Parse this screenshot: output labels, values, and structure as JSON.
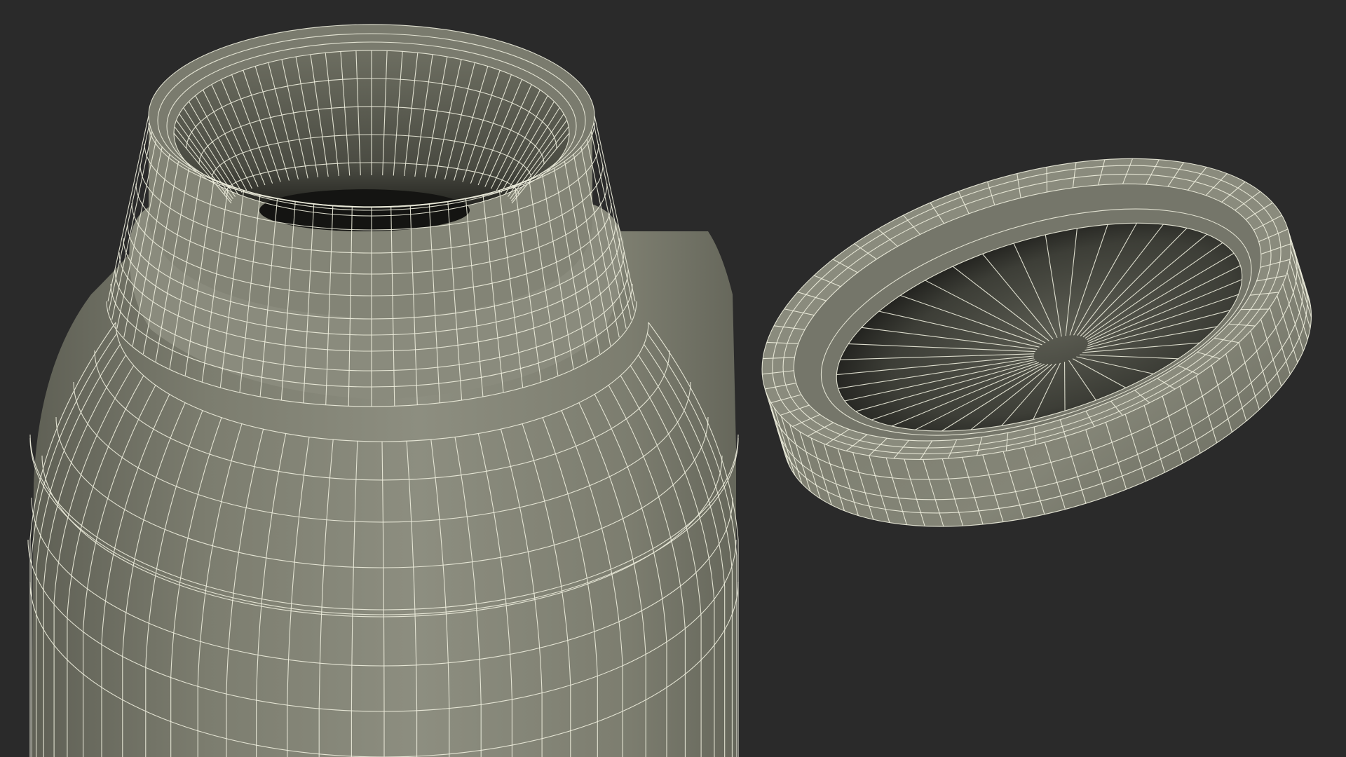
{
  "scene": {
    "description_visible_text": "",
    "objects": [
      {
        "name": "jar-body",
        "kind": "wireframe-mesh"
      },
      {
        "name": "jar-lid",
        "kind": "wireframe-mesh"
      }
    ]
  },
  "colors": {
    "background": "#2a2a2a",
    "mesh_surface": "#7c7d6f",
    "mesh_surface_light": "#8d8e80",
    "mesh_surface_dark": "#5f6055",
    "inner_shadow": "#1b1b18",
    "wire": "#eeeede"
  }
}
